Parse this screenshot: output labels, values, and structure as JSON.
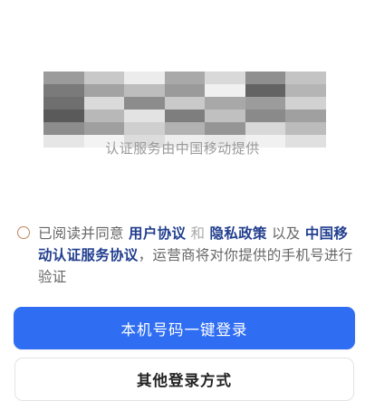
{
  "provider_note": "认证服务由中国移动提供",
  "agreement": {
    "prefix": "已阅读并同意",
    "user_agreement": "用户协议",
    "and": "和",
    "privacy_policy": "隐私政策",
    "also": "以及",
    "carrier_agreement": "中国移动认证服务协议",
    "suffix": "，运营商将对你提供的手机号进行验证"
  },
  "buttons": {
    "one_click_login": "本机号码一键登录",
    "other_login": "其他登录方式"
  },
  "colors": {
    "primary": "#2f6ef3",
    "link": "#223f8f"
  }
}
